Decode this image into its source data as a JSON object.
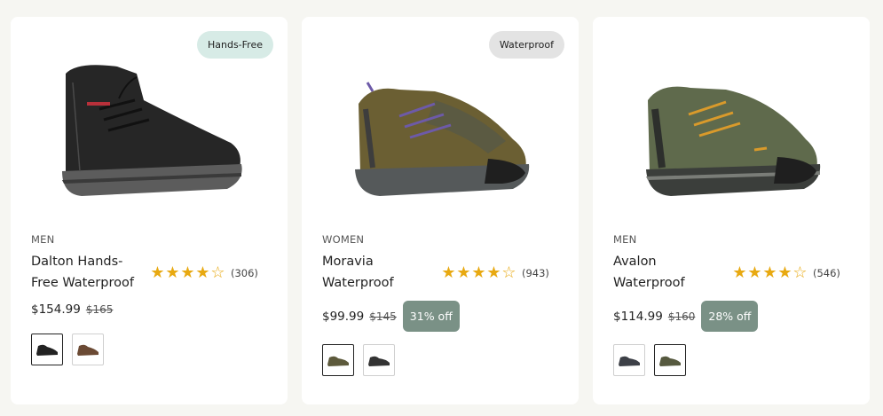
{
  "products": [
    {
      "badge": "Hands-Free",
      "gender": "MEN",
      "name": "Dalton Hands-Free Waterproof",
      "rating": 4.5,
      "review_count": "(306)",
      "price": "$154.99",
      "original_price": "$165",
      "discount": "",
      "shoe_colors": {
        "upper": "#262626",
        "sole": "#5c5c5c",
        "accent": "#b8303a"
      },
      "swatch_colors": [
        "#222222",
        "#6b4a34"
      ],
      "selected_swatch": 0
    },
    {
      "badge": "Waterproof",
      "gender": "WOMEN",
      "name": "Moravia Waterproof",
      "rating": 4.5,
      "review_count": "(943)",
      "price": "$99.99",
      "original_price": "$145",
      "discount": "31% off",
      "shoe_colors": {
        "upper": "#6b5f33",
        "sole": "#55595a",
        "accent": "#6d5aa8"
      },
      "swatch_colors": [
        "#5d5a3c",
        "#333333"
      ],
      "selected_swatch": 0
    },
    {
      "badge": "",
      "gender": "MEN",
      "name": "Avalon Waterproof",
      "rating": 4.5,
      "review_count": "(546)",
      "price": "$114.99",
      "original_price": "$160",
      "discount": "28% off",
      "shoe_colors": {
        "upper": "#5f6a4c",
        "sole": "#3b3e3b",
        "accent": "#d99a2b"
      },
      "swatch_colors": [
        "#3d4047",
        "#56593f"
      ],
      "selected_swatch": 1
    }
  ]
}
